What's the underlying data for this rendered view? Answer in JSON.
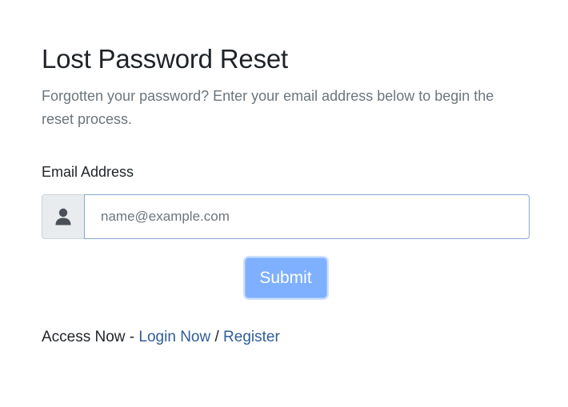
{
  "page": {
    "title": "Lost Password Reset",
    "subtitle": "Forgotten your password? Enter your email address below to begin the reset process."
  },
  "form": {
    "email_label": "Email Address",
    "email_placeholder": "name@example.com",
    "email_value": "",
    "prefix_icon": "user-icon",
    "submit_label": "Submit"
  },
  "footer": {
    "access_text": "Access Now - ",
    "login_label": "Login Now",
    "separator": " / ",
    "register_label": "Register"
  },
  "colors": {
    "link": "#2f5d99",
    "submit_bg": "#7fb0ff",
    "prefix_bg": "#e9ecef",
    "input_border_focus": "#86a9cf"
  }
}
